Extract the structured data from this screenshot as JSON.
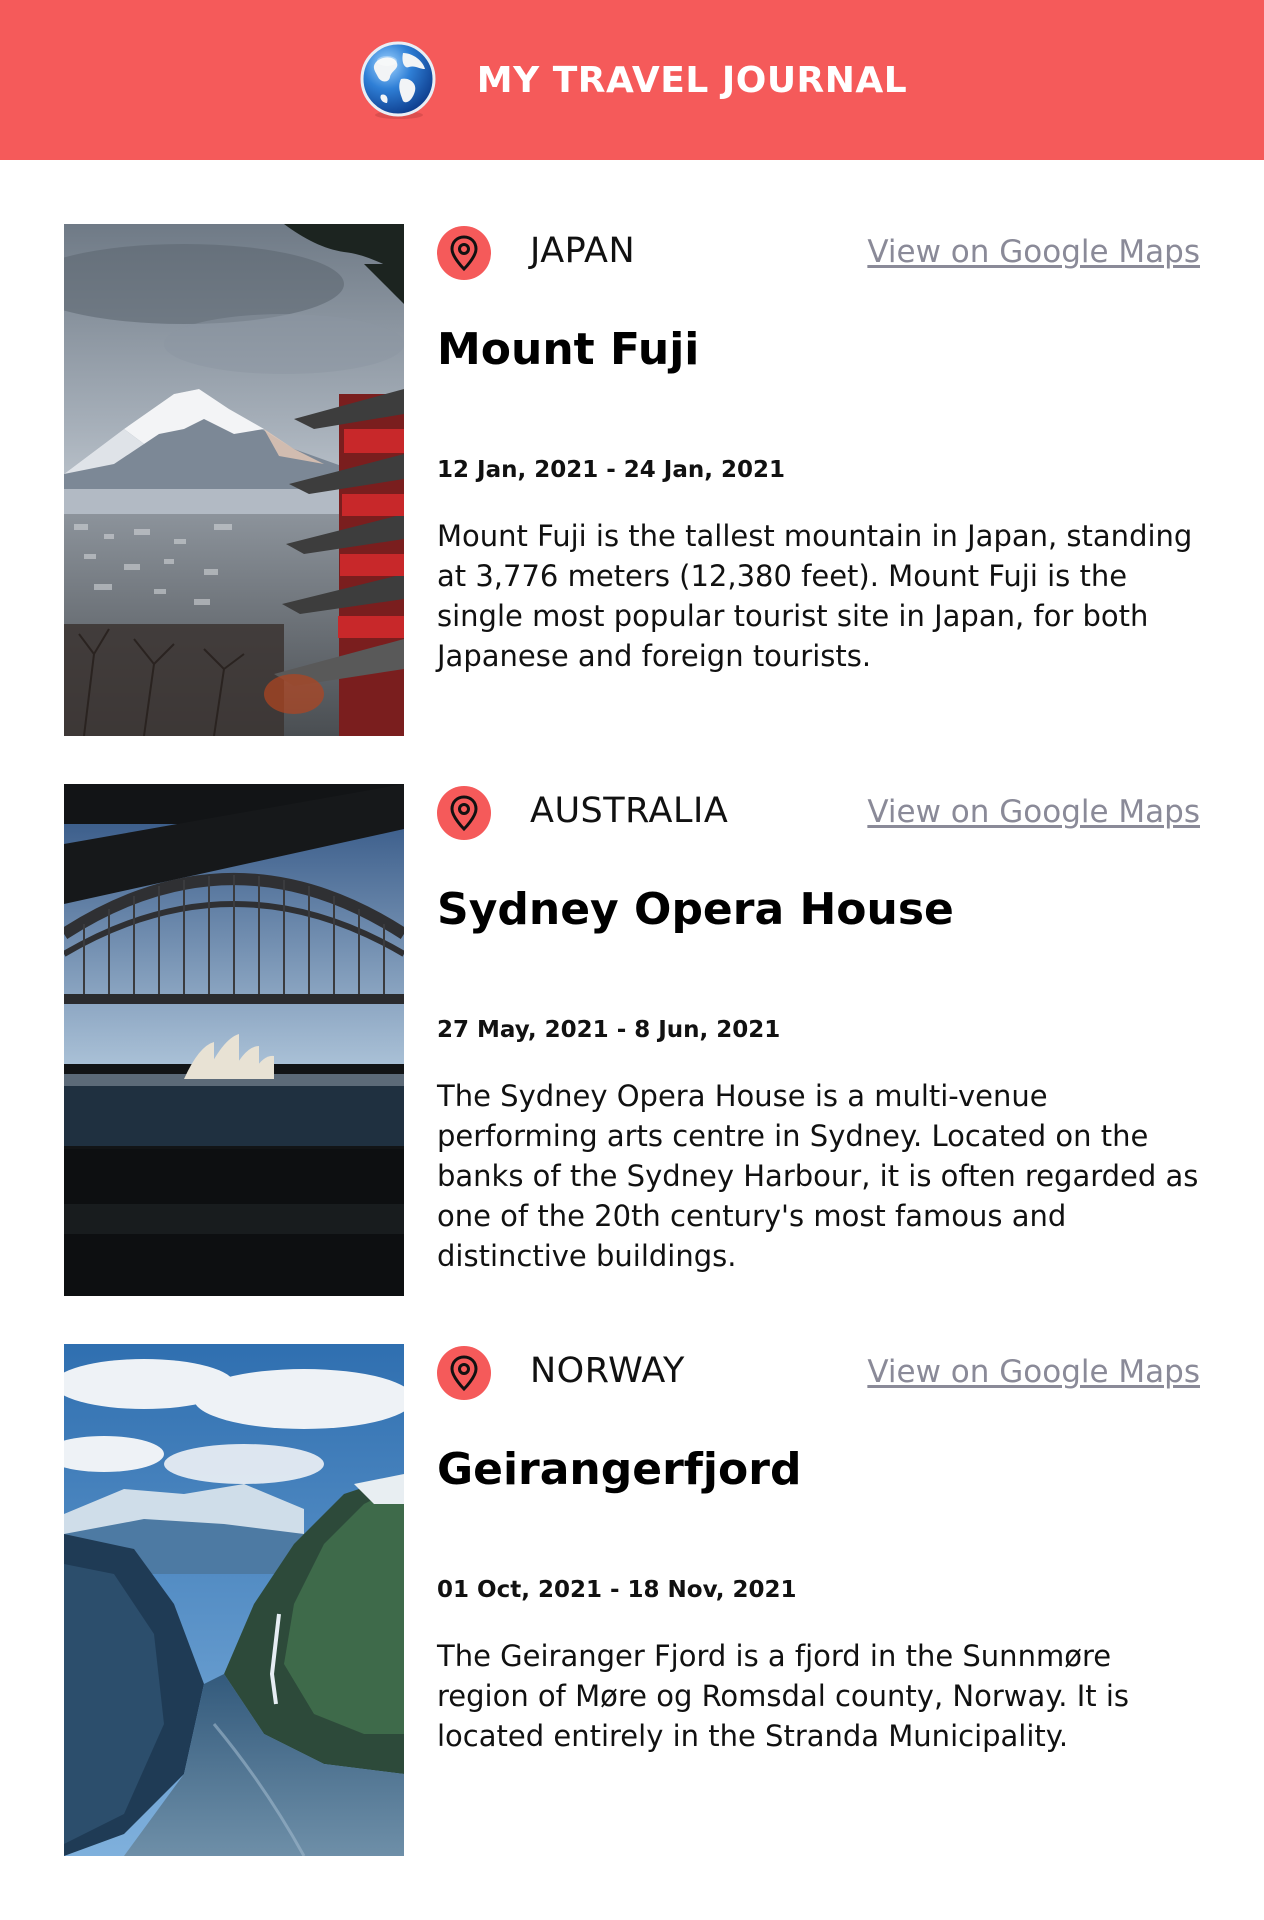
{
  "header": {
    "title": "MY TRAVEL JOURNAL",
    "logo_icon": "globe-icon",
    "background_color": "#f55a5a"
  },
  "link_color": "#8a8a98",
  "pin_color": "#f55a5a",
  "entries": [
    {
      "country": "JAPAN",
      "maps_link": "View on Google Maps",
      "place": "Mount Fuji",
      "dates": "12 Jan, 2021 - 24 Jan, 2021",
      "description": "Mount Fuji is the tallest mountain in Japan, standing at 3,776 meters (12,380 feet). Mount Fuji is the single most popular tourist site in Japan, for both Japanese and foreign tourists.",
      "pin_icon": "location-pin-icon"
    },
    {
      "country": "AUSTRALIA",
      "maps_link": "View on Google Maps",
      "place": "Sydney Opera House",
      "dates": "27 May, 2021 - 8 Jun, 2021",
      "description": "The Sydney Opera House is a multi-venue performing arts centre in Sydney. Located on the banks of the Sydney Harbour, it is often regarded as one of the 20th century's most famous and distinctive buildings.",
      "pin_icon": "location-pin-icon"
    },
    {
      "country": "NORWAY",
      "maps_link": "View on Google Maps",
      "place": "Geirangerfjord",
      "dates": "01 Oct, 2021 - 18 Nov, 2021",
      "description": "The Geiranger Fjord is a fjord in the Sunnmøre region of Møre og Romsdal county, Norway. It is located entirely in the Stranda Municipality.",
      "pin_icon": "location-pin-icon"
    }
  ]
}
